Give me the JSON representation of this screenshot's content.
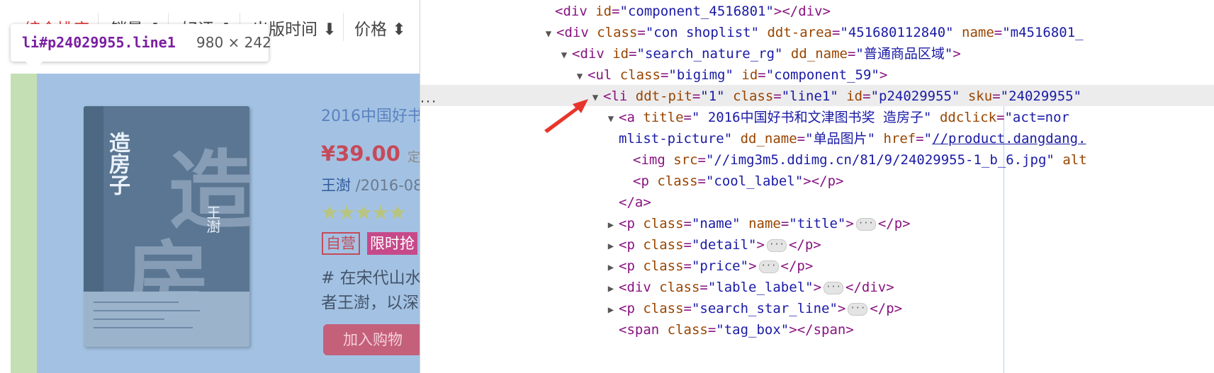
{
  "sortbar": {
    "items": [
      "综合排序",
      "销量",
      "好评",
      "出版时间",
      "价格"
    ],
    "arrow_down": "⬇",
    "arrow_updown": "⬍"
  },
  "inspector_tooltip": {
    "selector": "li#p24029955.line1",
    "dimensions": "980 × 242"
  },
  "product": {
    "title": "2016中国好书",
    "price": "¥39.00",
    "price_note": "定",
    "author": "王澍",
    "date": " /2016-08",
    "stars": "★★★★★",
    "badge_self": "自营",
    "badge_sale": "限时抢",
    "desc_line1": "# 在宋代山水",
    "desc_line2": "者王澍，以深",
    "cart": "加入购物",
    "cover_title": "造房子",
    "cover_author": "王澍",
    "cover_big1": "造",
    "cover_big2": "房"
  },
  "devtools": {
    "dots": "···",
    "lines": [
      {
        "parts": [
          [
            "tag",
            "<div "
          ],
          [
            "attr",
            "id"
          ],
          [
            "tag",
            "="
          ],
          [
            "val",
            "\"component_4516801\""
          ],
          [
            "tag",
            "></div>"
          ]
        ]
      },
      {
        "parts": [
          [
            "tag",
            "<div "
          ],
          [
            "attr",
            "class"
          ],
          [
            "tag",
            "="
          ],
          [
            "val",
            "\"con shoplist\" "
          ],
          [
            "attr",
            "ddt-area"
          ],
          [
            "tag",
            "="
          ],
          [
            "val",
            "\"451680112840\" "
          ],
          [
            "attr",
            "name"
          ],
          [
            "tag",
            "="
          ],
          [
            "val",
            "\"m4516801_"
          ]
        ]
      },
      {
        "parts": [
          [
            "tag",
            "<div "
          ],
          [
            "attr",
            "id"
          ],
          [
            "tag",
            "="
          ],
          [
            "val",
            "\"search_nature_rg\" "
          ],
          [
            "attr",
            "dd_name"
          ],
          [
            "tag",
            "="
          ],
          [
            "val",
            "\"普通商品区域\""
          ],
          [
            "tag",
            ">"
          ]
        ]
      },
      {
        "parts": [
          [
            "tag",
            "<ul "
          ],
          [
            "attr",
            "class"
          ],
          [
            "tag",
            "="
          ],
          [
            "val",
            "\"bigimg\" "
          ],
          [
            "attr",
            "id"
          ],
          [
            "tag",
            "="
          ],
          [
            "val",
            "\"component_59\""
          ],
          [
            "tag",
            ">"
          ]
        ]
      },
      {
        "parts": [
          [
            "tag",
            "<li "
          ],
          [
            "attr",
            "ddt-pit"
          ],
          [
            "tag",
            "="
          ],
          [
            "val",
            "\"1\" "
          ],
          [
            "attr",
            "class"
          ],
          [
            "tag",
            "="
          ],
          [
            "val",
            "\"line1\" "
          ],
          [
            "attr",
            "id"
          ],
          [
            "tag",
            "="
          ],
          [
            "val",
            "\"p24029955\" "
          ],
          [
            "attr",
            "sku"
          ],
          [
            "tag",
            "="
          ],
          [
            "val",
            "\"24029955\""
          ]
        ]
      },
      {
        "parts": [
          [
            "tag",
            "<a "
          ],
          [
            "attr",
            "title"
          ],
          [
            "tag",
            "="
          ],
          [
            "val",
            "\" 2016中国好书和文津图书奖 造房子\" "
          ],
          [
            "attr",
            "ddclick"
          ],
          [
            "tag",
            "="
          ],
          [
            "val",
            "\"act=nor"
          ]
        ]
      },
      {
        "parts": [
          [
            "val",
            "mlist-picture\" "
          ],
          [
            "attr",
            "dd_name"
          ],
          [
            "tag",
            "="
          ],
          [
            "val",
            "\"单品图片\" "
          ],
          [
            "attr",
            "href"
          ],
          [
            "tag",
            "="
          ],
          [
            "val",
            "\""
          ],
          [
            "link",
            "//product.dangdang."
          ]
        ]
      },
      {
        "parts": [
          [
            "tag",
            "<img "
          ],
          [
            "attr",
            "src"
          ],
          [
            "tag",
            "="
          ],
          [
            "val",
            "\"//img3m5.ddimg.cn/81/9/24029955-1_b_6.jpg\" "
          ],
          [
            "attr",
            "alt"
          ]
        ]
      },
      {
        "parts": [
          [
            "tag",
            "<p "
          ],
          [
            "attr",
            "class"
          ],
          [
            "tag",
            "="
          ],
          [
            "val",
            "\"cool_label\""
          ],
          [
            "tag",
            "></p>"
          ]
        ]
      },
      {
        "parts": [
          [
            "tag",
            "</a>"
          ]
        ]
      },
      {
        "parts": [
          [
            "tag",
            "<p "
          ],
          [
            "attr",
            "class"
          ],
          [
            "tag",
            "="
          ],
          [
            "val",
            "\"name\" "
          ],
          [
            "attr",
            "name"
          ],
          [
            "tag",
            "="
          ],
          [
            "val",
            "\"title\""
          ],
          [
            "tag",
            ">"
          ],
          [
            "ell",
            ""
          ],
          [
            "tag",
            "</p>"
          ]
        ]
      },
      {
        "parts": [
          [
            "tag",
            "<p "
          ],
          [
            "attr",
            "class"
          ],
          [
            "tag",
            "="
          ],
          [
            "val",
            "\"detail\""
          ],
          [
            "tag",
            ">"
          ],
          [
            "ell",
            ""
          ],
          [
            "tag",
            "</p>"
          ]
        ]
      },
      {
        "parts": [
          [
            "tag",
            "<p "
          ],
          [
            "attr",
            "class"
          ],
          [
            "tag",
            "="
          ],
          [
            "val",
            "\"price\""
          ],
          [
            "tag",
            ">"
          ],
          [
            "ell",
            ""
          ],
          [
            "tag",
            "</p>"
          ]
        ]
      },
      {
        "parts": [
          [
            "tag",
            "<div "
          ],
          [
            "attr",
            "class"
          ],
          [
            "tag",
            "="
          ],
          [
            "val",
            "\"lable_label\""
          ],
          [
            "tag",
            ">"
          ],
          [
            "ell",
            ""
          ],
          [
            "tag",
            "</div>"
          ]
        ]
      },
      {
        "parts": [
          [
            "tag",
            "<p "
          ],
          [
            "attr",
            "class"
          ],
          [
            "tag",
            "="
          ],
          [
            "val",
            "\"search_star_line\""
          ],
          [
            "tag",
            ">"
          ],
          [
            "ell",
            ""
          ],
          [
            "tag",
            "</p>"
          ]
        ]
      },
      {
        "parts": [
          [
            "tag",
            "<span "
          ],
          [
            "attr",
            "class"
          ],
          [
            "tag",
            "="
          ],
          [
            "val",
            "\"tag_box\""
          ],
          [
            "tag",
            "></span>"
          ]
        ]
      }
    ]
  },
  "colors": {
    "accent_red": "#e4393c",
    "tag_purple": "#881280",
    "attr_brown": "#994500",
    "value_blue": "#1a1aa6",
    "arrow_red": "#e8352b"
  }
}
